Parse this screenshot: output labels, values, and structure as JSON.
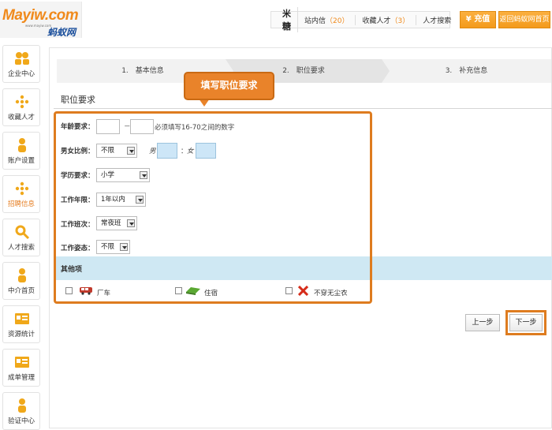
{
  "header": {
    "logo_text": "Mayiw.com",
    "logo_cn": "蚂蚁网",
    "logo_url": "www.mayiw.com",
    "user_name": "米糖",
    "links": [
      {
        "label": "站内信",
        "count": "（20）"
      },
      {
        "label": "收藏人才",
        "count": "（3）"
      },
      {
        "label": "人才搜索",
        "count": ""
      }
    ],
    "recharge_label": "充值",
    "home_label": "返回蚂蚁网首页"
  },
  "sidebar": {
    "items": [
      {
        "label": "企业中心",
        "icon": "people-icon"
      },
      {
        "label": "收藏人才",
        "icon": "star-cross-icon"
      },
      {
        "label": "账户设置",
        "icon": "user-settings-icon"
      },
      {
        "label": "招聘信息",
        "icon": "star-cross-icon"
      },
      {
        "label": "人才搜索",
        "icon": "search-icon"
      },
      {
        "label": "中介首页",
        "icon": "user-icon"
      },
      {
        "label": "资源统计",
        "icon": "card-icon"
      },
      {
        "label": "成单管理",
        "icon": "card-icon"
      },
      {
        "label": "验证中心",
        "icon": "user-icon"
      }
    ],
    "active_index": 3
  },
  "steps": [
    {
      "label": "1.　基本信息"
    },
    {
      "label": "2.　职位要求"
    },
    {
      "label": "3.　补充信息"
    }
  ],
  "callout": "填写职位要求",
  "section_title": "职位要求",
  "form": {
    "age_label": "年龄要求：",
    "age_sep": "－",
    "age_note": "必须填写16-70之间的数字",
    "gender_label": "男女比例：",
    "gender_value": "不限",
    "male_label": "男",
    "colon": "：",
    "female_label": "女",
    "education_label": "学历要求：",
    "education_value": "小学",
    "years_label": "工作年限：",
    "years_value": "1年以内",
    "shift_label": "工作班次：",
    "shift_value": "常夜班",
    "posture_label": "工作姿态：",
    "posture_value": "不限"
  },
  "other": {
    "label": "其他项",
    "options": [
      {
        "label": "厂车",
        "icon": "bus-icon"
      },
      {
        "label": "住宿",
        "icon": "bed-icon"
      },
      {
        "label": "不穿无尘衣",
        "icon": "no-cleanroom-suit-icon"
      }
    ]
  },
  "nav": {
    "prev_label": "上一步",
    "next_label": "下一步"
  },
  "colors": {
    "accent": "#de7c1f",
    "highlight_bar": "#cfe8f3"
  }
}
